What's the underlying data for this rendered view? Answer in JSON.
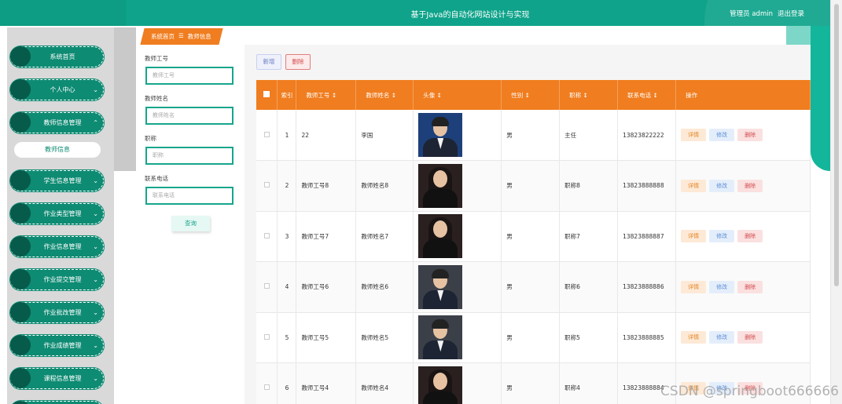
{
  "header": {
    "title": "基于Java的自动化网站设计与实现",
    "user_label": "管理员 admin",
    "logout": "退出登录"
  },
  "sidebar": {
    "items": [
      {
        "label": "系统首页",
        "has_chevron": false
      },
      {
        "label": "个人中心",
        "has_chevron": true
      },
      {
        "label": "教师信息管理",
        "has_chevron": true
      },
      {
        "label": "学生信息管理",
        "has_chevron": true
      },
      {
        "label": "作业类型管理",
        "has_chevron": true
      },
      {
        "label": "作业信息管理",
        "has_chevron": true
      },
      {
        "label": "作业提交管理",
        "has_chevron": true
      },
      {
        "label": "作业批改管理",
        "has_chevron": true
      },
      {
        "label": "作业成绩管理",
        "has_chevron": true
      },
      {
        "label": "课程信息管理",
        "has_chevron": true
      }
    ],
    "sub_item": "教师信息"
  },
  "breadcrumb": {
    "home": "系统首页",
    "sep": "☰",
    "current": "教师信息"
  },
  "search": {
    "fields": [
      {
        "label": "教师工号",
        "placeholder": "教师工号"
      },
      {
        "label": "教师姓名",
        "placeholder": "教师姓名"
      },
      {
        "label": "职称",
        "placeholder": "职称"
      },
      {
        "label": "联系电话",
        "placeholder": "联系电话"
      }
    ],
    "query_button": "查询"
  },
  "toolbar": {
    "new": "新增",
    "delete": "删除"
  },
  "table": {
    "headers": [
      "索引",
      "教师工号 ↕",
      "教师姓名 ↕",
      "头像 ↕",
      "性别 ↕",
      "职称 ↕",
      "联系电话 ↕",
      "操作"
    ],
    "actions": {
      "detail": "详情",
      "edit": "修改",
      "delete": "删除"
    },
    "rows": [
      {
        "index": "1",
        "id": "22",
        "name": "李国",
        "gender": "男",
        "title": "主任",
        "phone": "13823822222",
        "photo": "male"
      },
      {
        "index": "2",
        "id": "教师工号8",
        "name": "教师姓名8",
        "gender": "男",
        "title": "职称8",
        "phone": "13823888888",
        "photo": "female"
      },
      {
        "index": "3",
        "id": "教师工号7",
        "name": "教师姓名7",
        "gender": "男",
        "title": "职称7",
        "phone": "13823888887",
        "photo": "female"
      },
      {
        "index": "4",
        "id": "教师工号6",
        "name": "教师姓名6",
        "gender": "男",
        "title": "职称6",
        "phone": "13823888886",
        "photo": "male"
      },
      {
        "index": "5",
        "id": "教师工号5",
        "name": "教师姓名5",
        "gender": "男",
        "title": "职称5",
        "phone": "13823888885",
        "photo": "male"
      },
      {
        "index": "6",
        "id": "教师工号4",
        "name": "教师姓名4",
        "gender": "男",
        "title": "职称4",
        "phone": "13823888884",
        "photo": "female"
      }
    ]
  },
  "watermark": "CSDN @springboot666666",
  "colors": {
    "primary": "#0ea38a",
    "header_orange": "#f07d1f"
  }
}
